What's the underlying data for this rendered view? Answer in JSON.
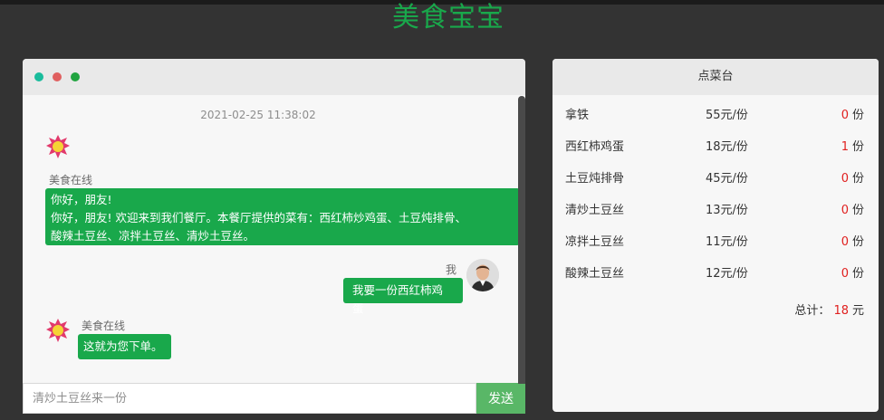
{
  "app": {
    "title": "美食宝宝"
  },
  "chat": {
    "timestamp": "2021-02-25 11:38:02",
    "messages": [
      {
        "sender": "美食在线",
        "line1": "你好，朋友!",
        "line2": "你好，朋友! 欢迎来到我们餐厅。本餐厅提供的菜有：西红柿炒鸡蛋、土豆炖排骨、",
        "line3": "酸辣土豆丝、凉拌土豆丝、清炒土豆丝。"
      },
      {
        "sender": "我",
        "text": "我要一份西红柿鸡蛋"
      },
      {
        "sender": "美食在线",
        "text": "这就为您下单。"
      }
    ],
    "input_value": "",
    "input_placeholder": "清炒土豆丝来一份",
    "send_label": "发送",
    "bot_badge_text": "美食"
  },
  "order": {
    "header": "点菜台",
    "unit_label": "份",
    "items": [
      {
        "name": "拿铁",
        "price": "55元/份",
        "qty": "0"
      },
      {
        "name": "西红柿鸡蛋",
        "price": "18元/份",
        "qty": "1"
      },
      {
        "name": "土豆炖排骨",
        "price": "45元/份",
        "qty": "0"
      },
      {
        "name": "清炒土豆丝",
        "price": "13元/份",
        "qty": "0"
      },
      {
        "name": "凉拌土豆丝",
        "price": "11元/份",
        "qty": "0"
      },
      {
        "name": "酸辣土豆丝",
        "price": "12元/份",
        "qty": "0"
      }
    ],
    "total_label": "总计：",
    "total_value": "18",
    "total_unit": "元"
  },
  "colors": {
    "brand_green": "#19a84b",
    "send_green": "#59b767",
    "qty_red": "#e0201f",
    "background": "#333333"
  },
  "icons": [
    "bot-avatar-icon",
    "user-avatar-icon"
  ]
}
